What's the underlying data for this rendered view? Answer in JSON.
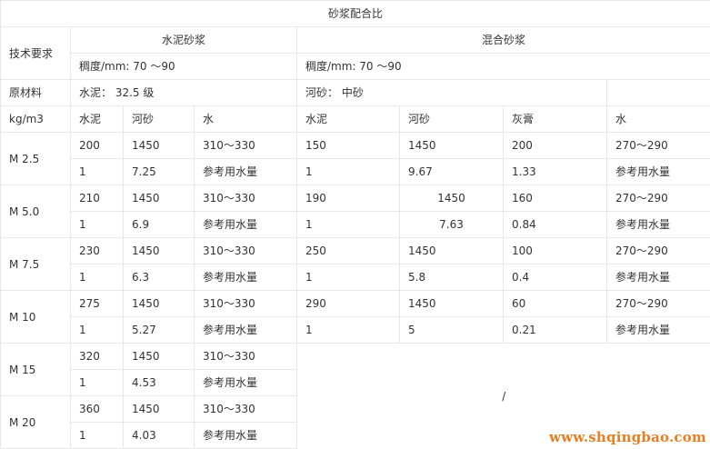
{
  "table": {
    "title": "砂浆配合比",
    "tech_req_label": "技术要求",
    "cement_mortar_label": "水泥砂浆",
    "mixed_mortar_label": "混合砂浆",
    "consistency_cement": "稠度/mm: 70 ～90",
    "consistency_mixed": "稠度/mm: 70 ～90",
    "raw_material_label": "原材料",
    "cement_grade": "水泥：  32.5 级",
    "river_sand_grade": "河砂：  中砂",
    "unit_label": "kg/m3",
    "cols": {
      "cement": "水泥",
      "sand": "河砂",
      "water": "水",
      "m_cement": "水泥",
      "m_sand": "河砂",
      "m_lime": "灰膏",
      "m_water": "水"
    },
    "rows": [
      {
        "grade": "M 2.5",
        "r1": [
          "200",
          "1450",
          "310～330",
          "150",
          "1450",
          "200",
          "270～290"
        ],
        "r2": [
          "1",
          "7.25",
          "参考用水量",
          "1",
          "9.67",
          "1.33",
          "参考用水量"
        ]
      },
      {
        "grade": "M 5.0",
        "r1": [
          "210",
          "1450",
          "310～330",
          "190",
          "1450",
          "160",
          "270～290"
        ],
        "r2": [
          "1",
          "6.9",
          "参考用水量",
          "1",
          "7.63",
          "0.84",
          "参考用水量"
        ]
      },
      {
        "grade": "M 7.5",
        "r1": [
          "230",
          "1450",
          "310～330",
          "250",
          "1450",
          "100",
          "270～290"
        ],
        "r2": [
          "1",
          "6.3",
          "参考用水量",
          "1",
          "5.8",
          "0.4",
          "参考用水量"
        ]
      },
      {
        "grade": "M 10",
        "r1": [
          "275",
          "1450",
          "310～330",
          "290",
          "1450",
          "60",
          "270～290"
        ],
        "r2": [
          "1",
          "5.27",
          "参考用水量",
          "1",
          "5",
          "0.21",
          "参考用水量"
        ]
      },
      {
        "grade": "M 15",
        "r1": [
          "320",
          "1450",
          "310～330"
        ],
        "r2": [
          "1",
          "4.53",
          "参考用水量"
        ]
      },
      {
        "grade": "M 20",
        "r1": [
          "360",
          "1450",
          "310～330"
        ],
        "r2": [
          "1",
          "4.03",
          "参考用水量"
        ]
      }
    ],
    "blank_mark": "/"
  },
  "watermark": "www.shqingbao.com"
}
